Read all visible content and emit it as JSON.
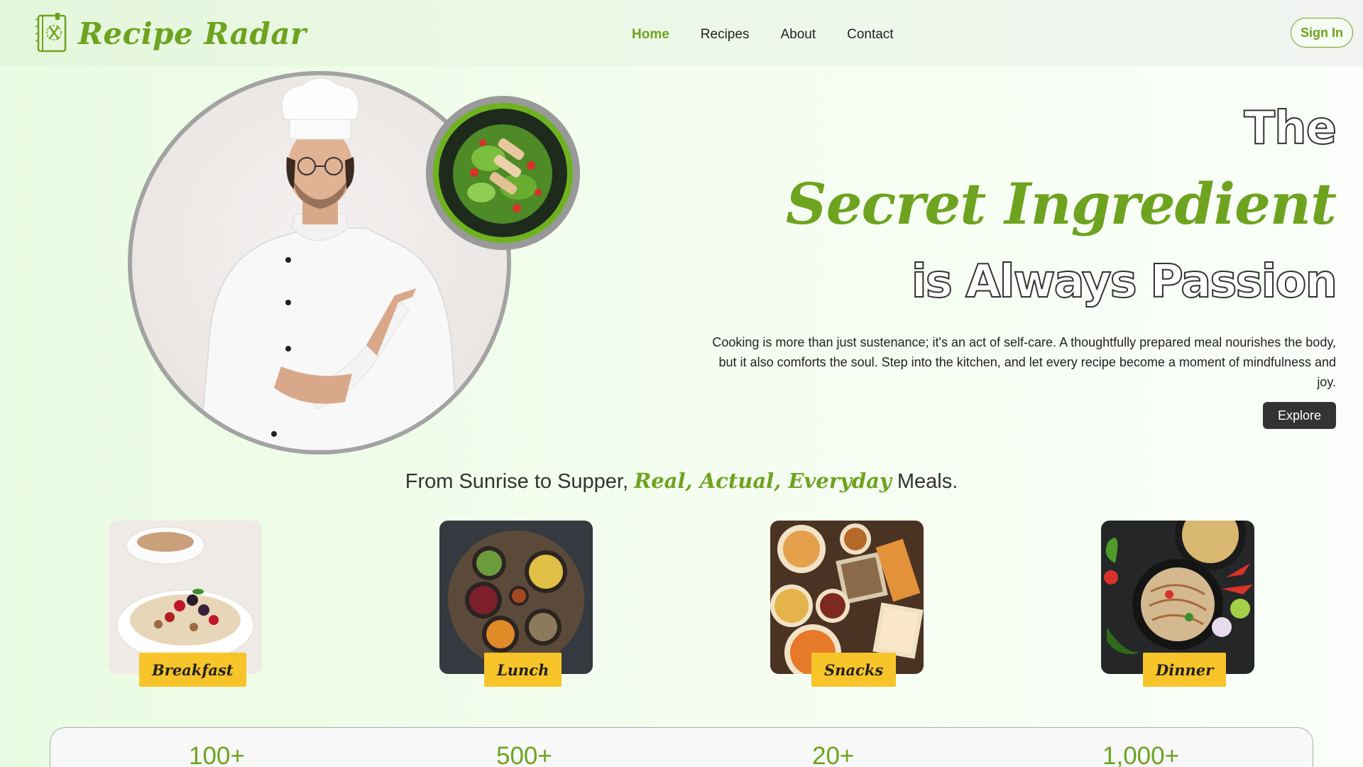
{
  "nav": {
    "logo_text": "Recipe Radar",
    "links": [
      "Home",
      "Recipes",
      "About",
      "Contact"
    ],
    "active": "Home",
    "signin_label": "Sign In"
  },
  "hero": {
    "line1": "The",
    "line2": "Secret Ingredient",
    "line3": "is Always Passion",
    "description": "Cooking is more than just sustenance; it's an act of self-care. A thoughtfully prepared meal nourishes the body, but it also comforts the soul. Step into the kitchen, and let every recipe become a moment of mindfulness and joy.",
    "button_label": "Explore"
  },
  "meals": {
    "heading_pre": "From Sunrise to Supper,",
    "heading_accent": "Real, Actual, Everyday",
    "heading_post": "Meals.",
    "items": [
      {
        "label": "Breakfast"
      },
      {
        "label": "Lunch"
      },
      {
        "label": "Snacks"
      },
      {
        "label": "Dinner"
      }
    ]
  },
  "stats": [
    "100+",
    "500+",
    "20+",
    "1,000+"
  ],
  "colors": {
    "accent": "#6ea31f",
    "label_bg": "#f7c429",
    "button_dark": "#333333"
  }
}
